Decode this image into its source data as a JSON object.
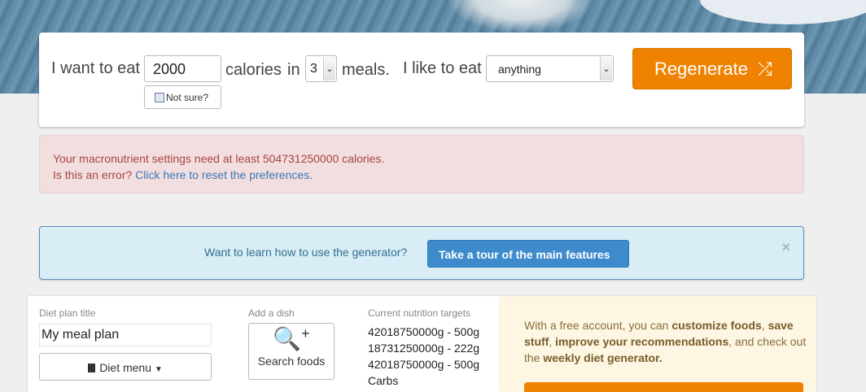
{
  "hero": {
    "image": "denim-background"
  },
  "generator": {
    "eat_prefix": "I want to eat",
    "calories_value": "2000",
    "calories_label": "calories",
    "in_label": "in",
    "meals_value": "3",
    "meals_label": "meals.",
    "like_label": "I like to eat",
    "diet_value": "anything",
    "not_sure_label": "Not sure?",
    "regenerate_label": "Regenerate",
    "accent": "#ef8200"
  },
  "alert": {
    "line1": "Your macronutrient settings need at least 504731250000 calories.",
    "line2_prefix": "Is this an error?",
    "line2_link": "Click here to reset the preferences."
  },
  "tour": {
    "question": "Want to learn how to use the generator?",
    "button": "Take a tour of the main features",
    "close": "×"
  },
  "plan": {
    "title_label": "Diet plan title",
    "title_value": "My meal plan",
    "diet_menu_label": "Diet menu",
    "add_dish_label": "Add a dish",
    "search_foods_label": "Search foods",
    "targets_label": "Current nutrition targets",
    "targets": [
      "42018750000g - 500g",
      "18731250000g - 222g",
      "42018750000g - 500g",
      "Carbs"
    ]
  },
  "promo": {
    "t1": "With a free account, you can ",
    "b1": "customize foods",
    "t2": ", ",
    "b2": "save stuff",
    "t3": ", ",
    "b3": "improve your recommendations",
    "t4": ", and check out the ",
    "b4": "weekly diet generator."
  }
}
